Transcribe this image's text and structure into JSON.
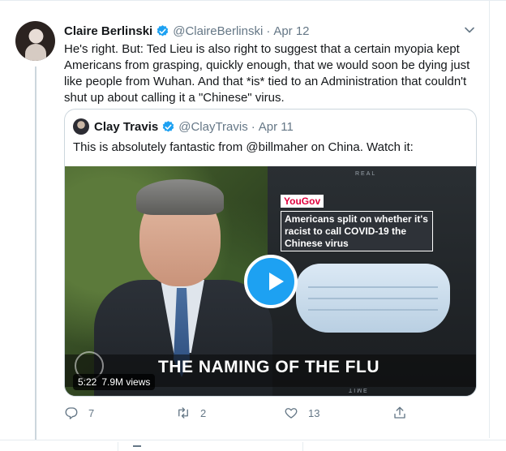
{
  "tweet": {
    "author_name": "Claire Berlinski",
    "author_handle": "@ClaireBerlinski",
    "separator": "·",
    "date": "Apr 12",
    "text": "He's right. But: Ted Lieu is also right to suggest that a certain myopia kept Americans from grasping, quickly enough, that we would soon be dying just like people from Wuhan. And that *is* tied to an Administration that couldn't shut up about calling it a \"Chinese\" virus."
  },
  "quoted_tweet": {
    "author_name": "Clay Travis",
    "author_handle": "@ClayTravis",
    "separator": "·",
    "date": "Apr 11",
    "text": "This is absolutely fantastic from @billmaher on China. Watch it:",
    "video": {
      "watermark": "REAL",
      "poll_brand": "YouGov",
      "poll_headline": "Americans split on whether it's racist to call COVID-19 the Chinese virus",
      "caption": "THE NAMING OF THE FLU",
      "duration": "5:22",
      "views": "7.9M views",
      "bottom_watermark": "TIME"
    }
  },
  "actions": {
    "reply_count": "7",
    "retweet_count": "2",
    "like_count": "13",
    "share_count": ""
  },
  "colors": {
    "accent": "#1da1f2",
    "text_primary": "#14171a",
    "text_secondary": "#657786",
    "border": "#ccd6dd",
    "yougov_red": "#e0003d"
  },
  "icons": {
    "verified": "verified-badge-icon",
    "caret": "chevron-down-icon",
    "play": "play-icon",
    "reply": "reply-icon",
    "retweet": "retweet-icon",
    "like": "heart-icon",
    "share": "share-icon"
  }
}
